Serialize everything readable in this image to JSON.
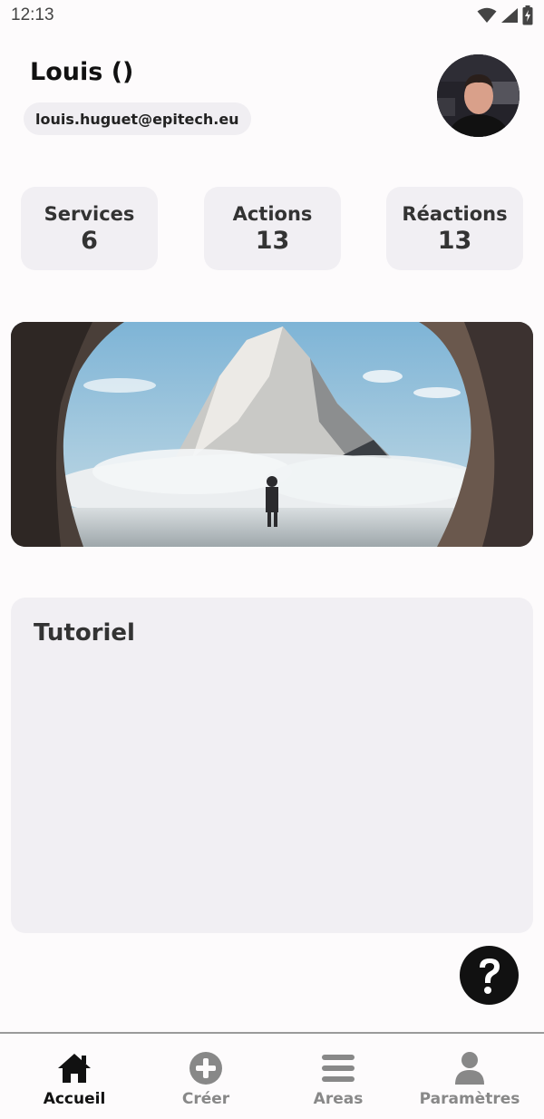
{
  "status_bar": {
    "time": "12:13",
    "icons": [
      "wifi-icon",
      "signal-icon",
      "battery-charging-icon"
    ]
  },
  "profile": {
    "name": "Louis ()",
    "email": "louis.huguet@epitech.eu"
  },
  "stats": [
    {
      "label": "Services",
      "value": "6"
    },
    {
      "label": "Actions",
      "value": "13"
    },
    {
      "label": "Réactions",
      "value": "13"
    }
  ],
  "tutorial": {
    "title": "Tutoriel"
  },
  "help_button": {
    "icon": "question-icon"
  },
  "bottom_nav": [
    {
      "label": "Accueil",
      "icon": "home-icon",
      "active": true
    },
    {
      "label": "Créer",
      "icon": "plus-circle-icon",
      "active": false
    },
    {
      "label": "Areas",
      "icon": "menu-icon",
      "active": false
    },
    {
      "label": "Paramètres",
      "icon": "person-icon",
      "active": false
    }
  ],
  "colors": {
    "background": "#fdfbfc",
    "card": "#f1eff3",
    "text_dark": "#111111",
    "nav_inactive": "#888888"
  }
}
